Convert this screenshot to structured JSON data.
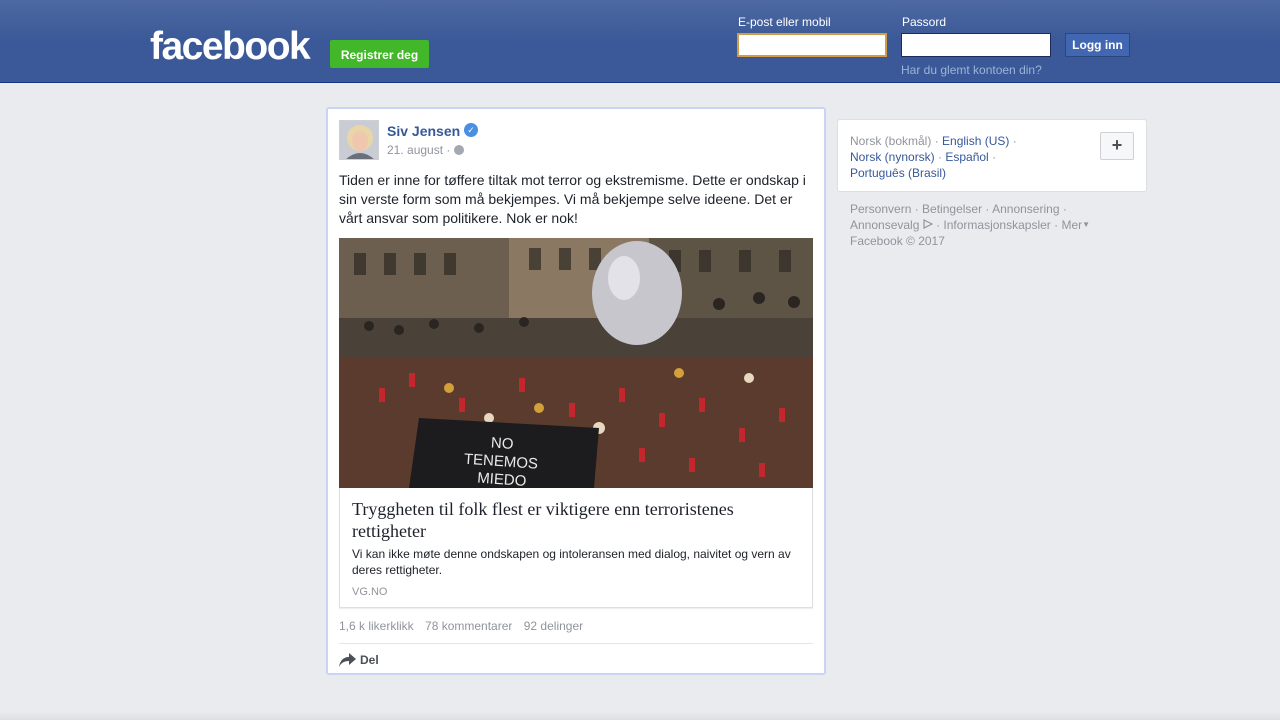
{
  "header": {
    "logo": "facebook",
    "register_label": "Registrer deg",
    "email_label": "E-post eller mobil",
    "email_value": "",
    "password_label": "Passord",
    "password_value": "",
    "login_label": "Logg inn",
    "forgot_label": "Har du glemt kontoen din?"
  },
  "post": {
    "author": "Siv Jensen",
    "date": "21. august",
    "date_separator": "·",
    "text": "Tiden er inne for tøffere tiltak mot terror og ekstremisme. Dette er ondskap i sin verste form som må bekjempes. Vi må bekjempe selve ideene. Det er vårt ansvar som politikere. Nok er nok!",
    "link": {
      "title": "Tryggheten til folk flest er viktigere enn terroristenes rettigheter",
      "description": "Vi kan ikke møte denne ondskapen og intoleransen med dialog, naivitet og vern av deres rettigheter.",
      "domain": "VG.NO"
    },
    "image_sign_text": "NO TENEMOS MIEDO",
    "stats": {
      "likes": "1,6 k likerklikk",
      "comments": "78 kommentarer",
      "shares": "92 delinger"
    },
    "share_label": "Del"
  },
  "sidebar": {
    "languages": [
      {
        "label": "Norsk (bokmål)"
      },
      {
        "label": "English (US)"
      },
      {
        "label": "Norsk (nynorsk)"
      },
      {
        "label": "Español"
      },
      {
        "label": "Português (Brasil)"
      }
    ],
    "add_language_label": "+",
    "footer": {
      "privacy": "Personvern",
      "terms": "Betingelser",
      "advertising": "Annonsering",
      "adchoices": "Annonsevalg",
      "cookies": "Informasjonskapsler",
      "more": "Mer",
      "copyright": "Facebook © 2017"
    }
  },
  "colors": {
    "brand_blue": "#3b5998",
    "register_green": "#42b72a",
    "link_blue": "#365899"
  }
}
